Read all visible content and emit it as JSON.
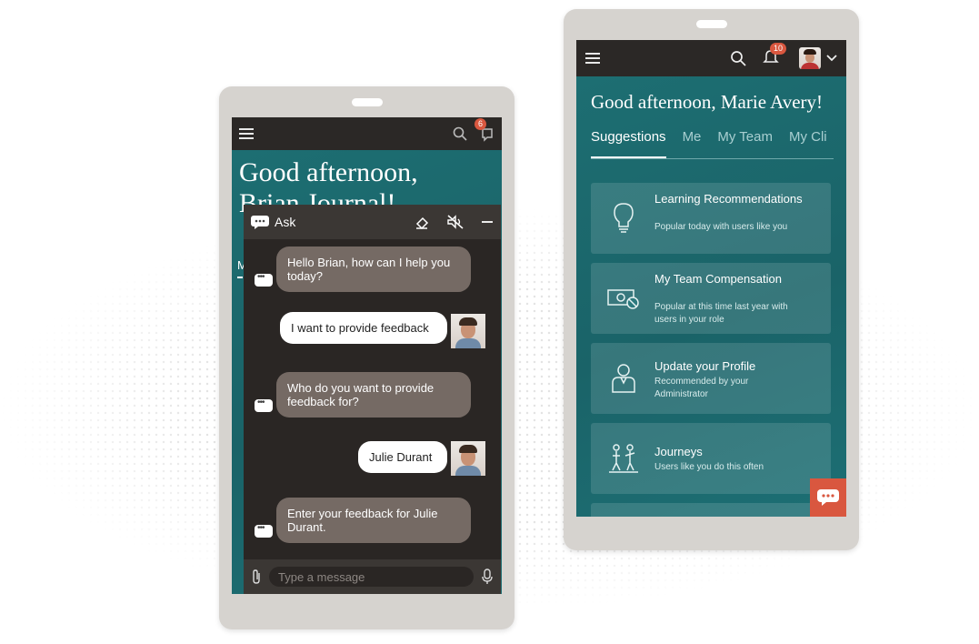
{
  "left_phone": {
    "greeting": "Good afternoon,",
    "greeting_partial": "Brian Journal!",
    "notification_count": "6",
    "chat": {
      "title": "Ask",
      "messages": [
        {
          "from": "bot",
          "text": "Hello Brian, how can I help you today?"
        },
        {
          "from": "user",
          "text": "I want to provide feedback"
        },
        {
          "from": "bot",
          "text": "Who do you want to provide feedback for?"
        },
        {
          "from": "user",
          "text": "Julie Durant"
        },
        {
          "from": "bot",
          "text": "Enter your feedback for Julie Durant."
        }
      ],
      "input_placeholder": "Type a message"
    }
  },
  "right_phone": {
    "greeting": "Good afternoon, Marie Avery!",
    "notification_count": "10",
    "tabs": [
      "Suggestions",
      "Me",
      "My Team",
      "My Cli"
    ],
    "active_tab": "Suggestions",
    "cards": [
      {
        "title": "Learning Recommendations",
        "subtitle": "Popular today with users like you",
        "icon": "lightbulb-icon"
      },
      {
        "title": "My Team Compensation",
        "subtitle": "Popular at this time last year with users in your role",
        "icon": "money-icon"
      },
      {
        "title": "Update your Profile",
        "subtitle": "Recommended by your Administrator",
        "icon": "person-icon"
      },
      {
        "title": "Journeys",
        "subtitle": "Users like you do this often",
        "icon": "journey-icon"
      }
    ]
  },
  "colors": {
    "teal": "#1d6e72",
    "topbar": "#2b2826",
    "accent": "#d9573f",
    "chat_bg": "#2a2624",
    "bot_bubble": "#756a64"
  }
}
